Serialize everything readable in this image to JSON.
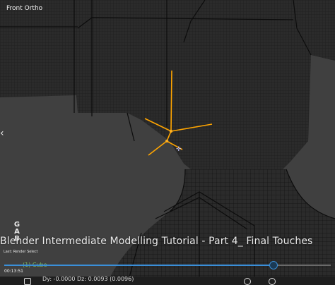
{
  "viewport": {
    "label": "Front Ortho",
    "mode_letters": [
      "G",
      "A",
      "B"
    ],
    "last_operator": "Last: Render Select",
    "object_name": "(1) Cube"
  },
  "video": {
    "title": "Blender Intermediate Modelling Tutorial - Part 4_ Final Touches",
    "time": "00:13:51",
    "progress": 0.82
  },
  "status_bar": {
    "text": "Dy: -0.0000  Dz: 0.0093 (0.0096)"
  },
  "colors": {
    "viewport_bg": "#404040",
    "mesh_face": "#2a2a2a",
    "wire": "#111111",
    "selected": "#ffa500",
    "progress_accent": "#3a8fd9",
    "object_label": "#7fbf5f"
  },
  "icons": [
    "left-arrow-icon",
    "mouse-cursor-icon",
    "playback-control-icon"
  ]
}
